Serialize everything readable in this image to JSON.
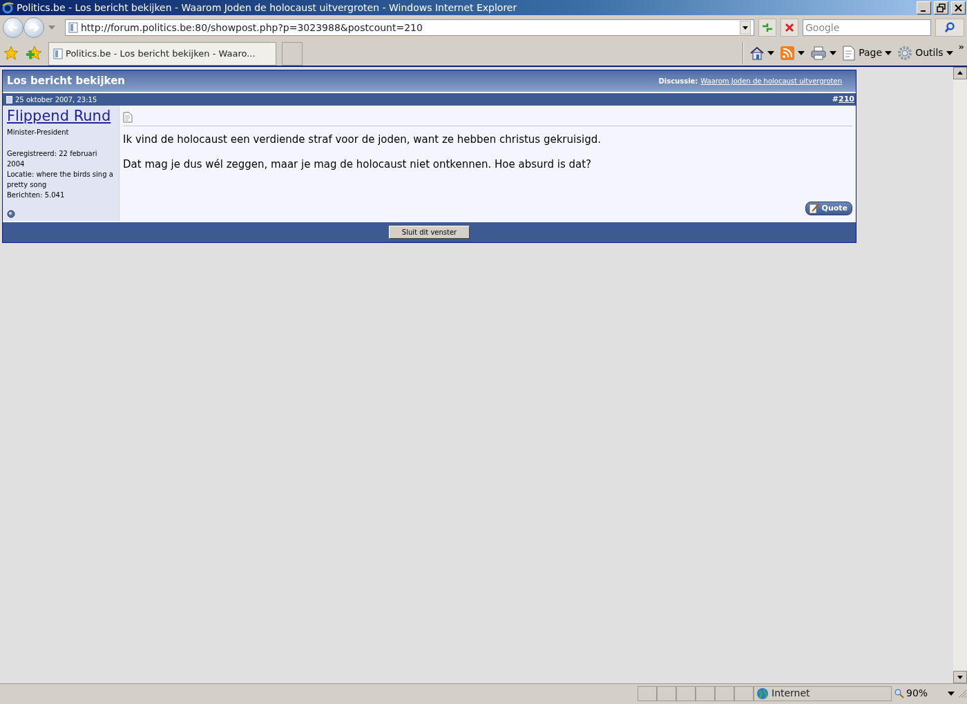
{
  "window": {
    "title": "Politics.be - Los bericht bekijken - Waarom Joden de holocaust uitvergroten - Windows Internet Explorer"
  },
  "address_bar": {
    "url": "http://forum.politics.be:80/showpost.php?p=3023988&postcount=210"
  },
  "search": {
    "placeholder": "Google"
  },
  "tabs": [
    {
      "label": "Politics.be - Los bericht bekijken - Waaro...",
      "selected": true
    }
  ],
  "command_bar": {
    "page_label": "Page",
    "tools_label": "Outils",
    "more": "»"
  },
  "page": {
    "header_title": "Los bericht bekijken",
    "discussion_label": "Discussie:",
    "discussion_link": "Waarom Joden de holocaust uitvergroten",
    "post": {
      "date": "25 oktober 2007, 23:15",
      "number_prefix": "#",
      "number": "210",
      "user": {
        "name": "Flippend Rund",
        "rank": "Minister-President",
        "info": [
          "Geregistreerd: 22 februari 2004",
          "Locatie: where the birds sing a pretty song",
          "Berichten: 5.041"
        ],
        "online": false
      },
      "paragraphs": [
        "Ik vind de holocaust een verdiende straf voor de joden, want ze hebben christus gekruisigd.",
        "Dat mag je dus wél zeggen, maar je mag de holocaust niet ontkennen. Hoe absurd is dat?"
      ],
      "quote_button": "Quote"
    },
    "close_button": "Sluit dit venster"
  },
  "status_bar": {
    "zone": "Internet",
    "zoom": "90%"
  }
}
